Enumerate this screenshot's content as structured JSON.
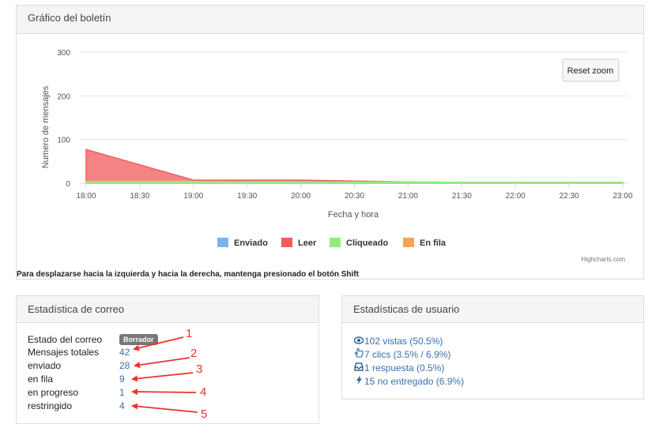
{
  "chart_panel": {
    "title": "Gráfico del boletín",
    "reset_zoom": "Reset zoom",
    "credits": "Highcharts.com",
    "note": "Para desplazarse hacia la izquierda y hacia la derecha, mantenga presionado el botón Shift"
  },
  "chart_data": {
    "type": "area",
    "xlabel": "Fecha y hora",
    "ylabel": "Numero de mensajes",
    "ylim": [
      0,
      300
    ],
    "yticks": [
      0,
      100,
      200,
      300
    ],
    "x": [
      "18:00",
      "18:30",
      "19:00",
      "19:30",
      "20:00",
      "20:30",
      "21:00",
      "21:30",
      "22:00",
      "22:30",
      "23:00"
    ],
    "legend_position": "bottom",
    "series": [
      {
        "name": "Enviado",
        "color": "#7cb5ec",
        "values": [
          0,
          0,
          0,
          0,
          0,
          0,
          0,
          0,
          0,
          0,
          0
        ]
      },
      {
        "name": "Leer",
        "color": "#f15c5c",
        "values": [
          77,
          42,
          7,
          7,
          7,
          5,
          3,
          2,
          2,
          2,
          2
        ]
      },
      {
        "name": "Cliqueado",
        "color": "#90ed7d",
        "values": [
          4,
          4,
          4,
          3,
          3,
          3,
          3,
          2,
          2,
          2,
          2
        ]
      },
      {
        "name": "En fila",
        "color": "#f7a35c",
        "values": [
          0,
          0,
          0,
          0,
          0,
          0,
          0,
          0,
          0,
          0,
          0
        ]
      }
    ]
  },
  "mail_stats": {
    "title": "Estadística de correo",
    "status_label": "Estado del correo",
    "status_badge": "Borrador",
    "rows": [
      {
        "label": "Mensajes totales",
        "value": "42"
      },
      {
        "label": "enviado",
        "value": "28"
      },
      {
        "label": "en fila",
        "value": "9"
      },
      {
        "label": "en progreso",
        "value": "1"
      },
      {
        "label": "restringido",
        "value": "4"
      }
    ]
  },
  "user_stats": {
    "title": "Estadísticas de usuario",
    "items": [
      {
        "icon": "eye-icon",
        "text": "102 vistas (50.5%)"
      },
      {
        "icon": "pointer-icon",
        "text": "7 clics (3.5% / 6.9%)"
      },
      {
        "icon": "inbox-icon",
        "text": "1 respuesta (0.5%)"
      },
      {
        "icon": "bolt-icon",
        "text": "15 no entregado (6.9%)"
      }
    ]
  },
  "annotations": {
    "color": "#e8352b",
    "numbers": [
      "1",
      "2",
      "3",
      "4",
      "5"
    ]
  }
}
